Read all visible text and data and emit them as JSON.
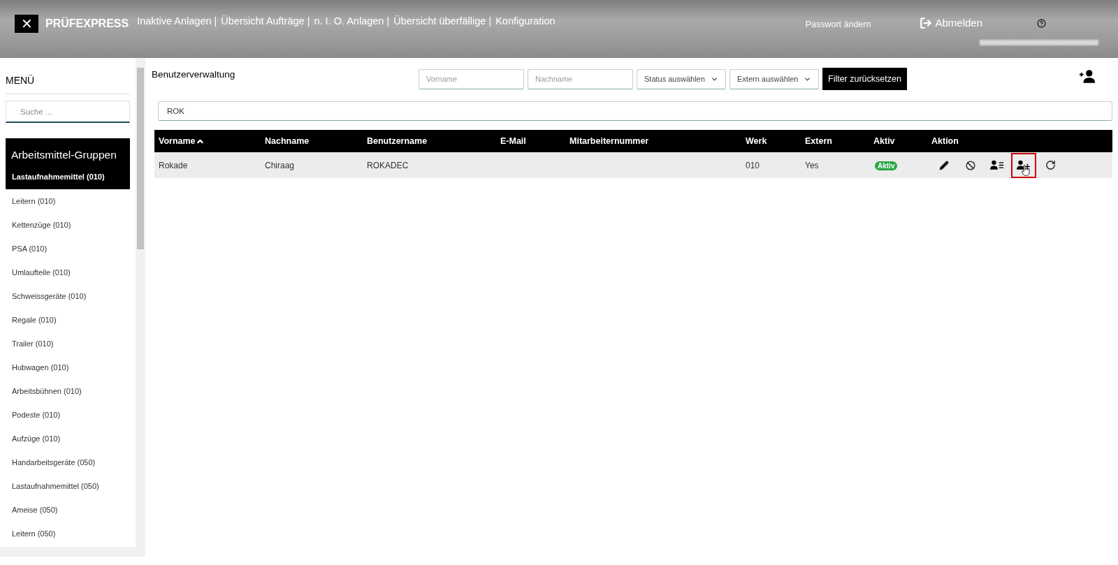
{
  "header": {
    "logo_mark": "✕",
    "brand": "PRÜFEXPRESS",
    "nav": [
      "Inaktive Anlagen |",
      "Übersicht Aufträge |",
      "n. I. O. Anlagen |",
      "Übersicht überfällige |",
      "Konfiguration"
    ],
    "password_link": "Passwort ändern",
    "logout": "Abmelden"
  },
  "sidebar": {
    "title": "MENÜ",
    "search": {
      "placeholder": "Suche ..."
    },
    "group_title": "Arbeitsmittel-Gruppen",
    "items": [
      {
        "label": "Lastaufnahmemittel (010)",
        "selected": true
      },
      {
        "label": "Leitern (010)",
        "selected": false
      },
      {
        "label": "Kettenzüge (010)",
        "selected": false
      },
      {
        "label": "PSA (010)",
        "selected": false
      },
      {
        "label": "Umlaufteile (010)",
        "selected": false
      },
      {
        "label": "Schweissgeräte (010)",
        "selected": false
      },
      {
        "label": "Regale (010)",
        "selected": false
      },
      {
        "label": "Trailer (010)",
        "selected": false
      },
      {
        "label": "Hubwagen (010)",
        "selected": false
      },
      {
        "label": "Arbeitsbühnen (010)",
        "selected": false
      },
      {
        "label": "Podeste (010)",
        "selected": false
      },
      {
        "label": "Aufzüge (010)",
        "selected": false
      },
      {
        "label": "Handarbeitsgeräte (050)",
        "selected": false
      },
      {
        "label": "Lastaufnahmemittel (050)",
        "selected": false
      },
      {
        "label": "Ameise (050)",
        "selected": false
      },
      {
        "label": "Leitern (050)",
        "selected": false
      }
    ]
  },
  "main": {
    "title": "Benutzerverwaltung",
    "filters": {
      "first_name": {
        "placeholder": "Vorname"
      },
      "last_name": {
        "placeholder": "Nachname"
      },
      "status_select": "Status auswählen",
      "extern_select": "Extern auswählen",
      "reset_button": "Filter zurücksetzen"
    },
    "search": {
      "value": "ROK"
    },
    "table": {
      "columns": [
        {
          "label": "Vorname",
          "sorted": true
        },
        {
          "label": "Nachname",
          "sorted": false
        },
        {
          "label": "Benutzername",
          "sorted": false
        },
        {
          "label": "E-Mail",
          "sorted": false
        },
        {
          "label": "Mitarbeiternummer",
          "sorted": false
        },
        {
          "label": "Werk",
          "sorted": false
        },
        {
          "label": "Extern",
          "sorted": false
        },
        {
          "label": "Aktiv",
          "sorted": false
        },
        {
          "label": "Aktion",
          "sorted": false
        }
      ],
      "rows": [
        {
          "cells": [
            "Rokade",
            "Chiraag",
            "ROKADEC",
            "",
            "",
            "010",
            "Yes"
          ],
          "status": "Aktiv",
          "active": true,
          "actions": [
            {
              "kind": "edit",
              "highlighted": false
            },
            {
              "kind": "disable",
              "highlighted": false
            },
            {
              "kind": "details",
              "highlighted": false
            },
            {
              "kind": "add",
              "highlighted": true
            },
            {
              "kind": "reset",
              "highlighted": false
            }
          ]
        }
      ]
    }
  }
}
